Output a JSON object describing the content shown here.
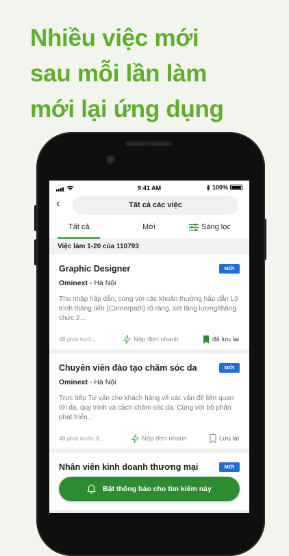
{
  "headline": [
    "Nhiều việc mới",
    "sau mỗi lần làm",
    "mới lại ứng dụng"
  ],
  "status": {
    "time": "9:41 AM",
    "battery": "100%"
  },
  "nav": {
    "title": "Tất cả các việc"
  },
  "tabs": {
    "all": "Tất cả",
    "new": "Mới",
    "filter": "Sàng lọc"
  },
  "count_label": "Việc làm 1-20 của 110793",
  "jobs": [
    {
      "title": "Graphic Designer",
      "badge": "MỚI",
      "company": "Ominext",
      "location": " - Hà Nội",
      "desc": "Thu nhập hấp dẫn, cùng với các khoản thưởng hấp dẫn Lộ trình thăng tiến (Careerpath) rõ ràng, xét tăng lương/thăng chức 2...",
      "ago": "48 phút trướ...",
      "quick_apply": "Nộp đơn nhanh",
      "save": "đã lưu lại"
    },
    {
      "title": "Chuyên viên đào tạo chăm sóc da",
      "badge": "MỚI",
      "company": "Ominext",
      "location": " - Hà Nội",
      "desc": "Trực tiếp Tư vấn cho khách hàng về các vấn đề liên quan tới da, quy trình và cách chăm sóc da. Cùng với bộ phận phát triển...",
      "ago": "48 phút trước đ...",
      "quick_apply": "Nộp đơn nhanh",
      "save": "Lưu lại"
    },
    {
      "title": "Nhân viên kinh doanh thương mại",
      "badge": "MỚI"
    }
  ],
  "cta": {
    "label": "Bật thông báo cho tìm kiếm này"
  },
  "colors": {
    "brand_green": "#5fae2c",
    "button_green": "#2f8b33",
    "badge_blue": "#1e6fd9"
  }
}
